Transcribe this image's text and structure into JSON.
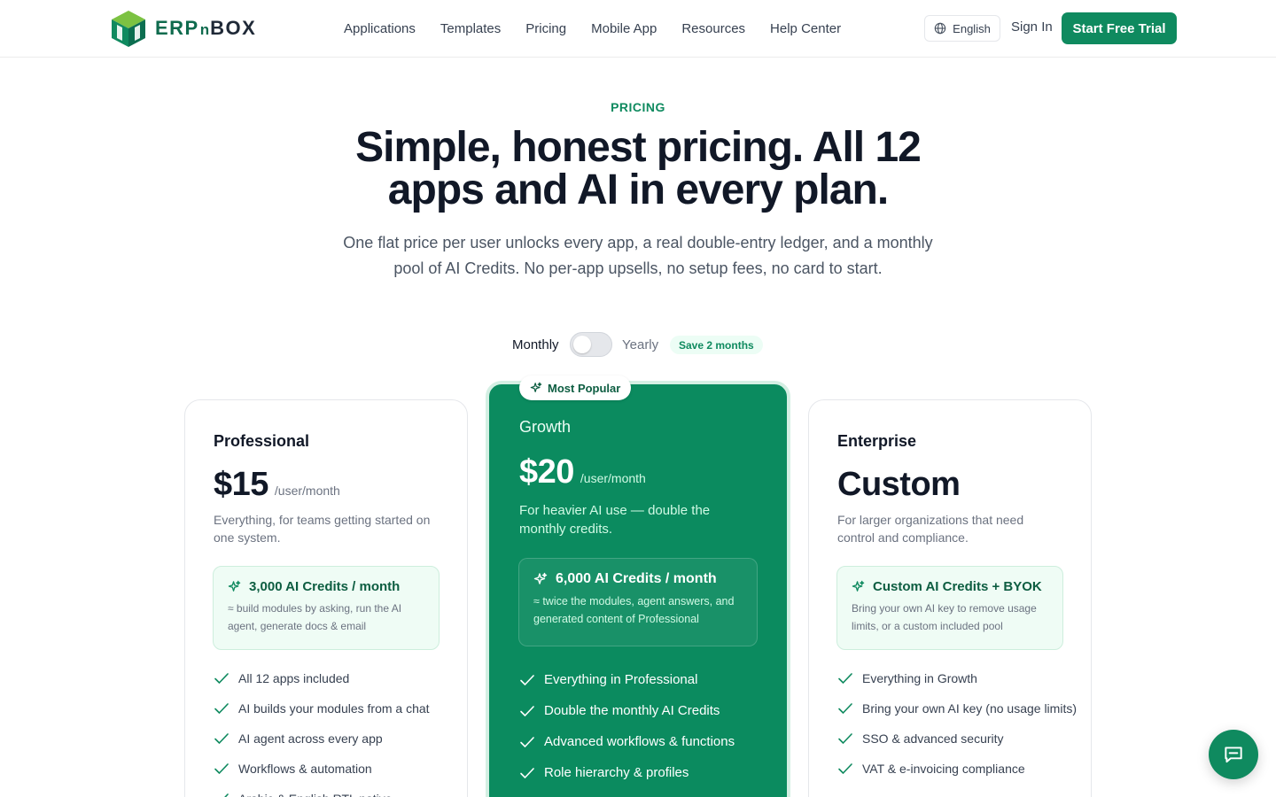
{
  "brand": {
    "logo_part1": "ERP",
    "logo_part2": "n",
    "logo_part3": "BOX",
    "primary_color": "#0f8a5f"
  },
  "nav": {
    "items": [
      "Applications",
      "Templates",
      "Pricing",
      "Mobile App",
      "Resources",
      "Help Center"
    ],
    "language": "English",
    "sign_in": "Sign In",
    "cta": "Start Free Trial"
  },
  "hero": {
    "eyebrow": "PRICING",
    "title_line1": "Simple, honest pricing. All 12",
    "title_line2": "apps and AI in every plan.",
    "subtitle_line1": "One flat price per user unlocks every app, a real double-entry ledger, and a monthly",
    "subtitle_line2": "pool of AI Credits. No per-app upsells, no setup fees, no card to start."
  },
  "billing": {
    "monthly_label": "Monthly",
    "yearly_label": "Yearly",
    "save_badge": "Save 2 months",
    "yearly_selected": false
  },
  "plans": [
    {
      "name": "Professional",
      "price": "$15",
      "per": "/user/month",
      "description": "Everything, for teams getting started on one system.",
      "credits_title": "3,000 AI Credits / month",
      "credits_body": "≈ build modules by asking, run the AI agent, generate docs & email",
      "features": [
        "All 12 apps included",
        "AI builds your modules from a chat",
        "AI agent across every app",
        "Workflows & automation",
        "Arabic & English RTL native"
      ]
    },
    {
      "name": "Growth",
      "badge": "Most Popular",
      "price": "$20",
      "per": "/user/month",
      "description": "For heavier AI use — double the monthly credits.",
      "credits_title": "6,000 AI Credits / month",
      "credits_body": "≈ twice the modules, agent answers, and generated content of Professional",
      "features": [
        "Everything in Professional",
        "Double the monthly AI Credits",
        "Advanced workflows & functions",
        "Role hierarchy & profiles"
      ]
    },
    {
      "name": "Enterprise",
      "price": "Custom",
      "per": "",
      "description": "For larger organizations that need control and compliance.",
      "credits_title": "Custom AI Credits + BYOK",
      "credits_body": "Bring your own AI key to remove usage limits, or a custom included pool",
      "features": [
        "Everything in Growth",
        "Bring your own AI key (no usage limits)",
        "SSO & advanced security",
        "VAT & e-invoicing compliance"
      ]
    }
  ],
  "icons": {
    "check": "check-icon",
    "sparkle": "sparkle-icon",
    "globe": "globe-icon",
    "chat": "chat-bubble-icon"
  }
}
